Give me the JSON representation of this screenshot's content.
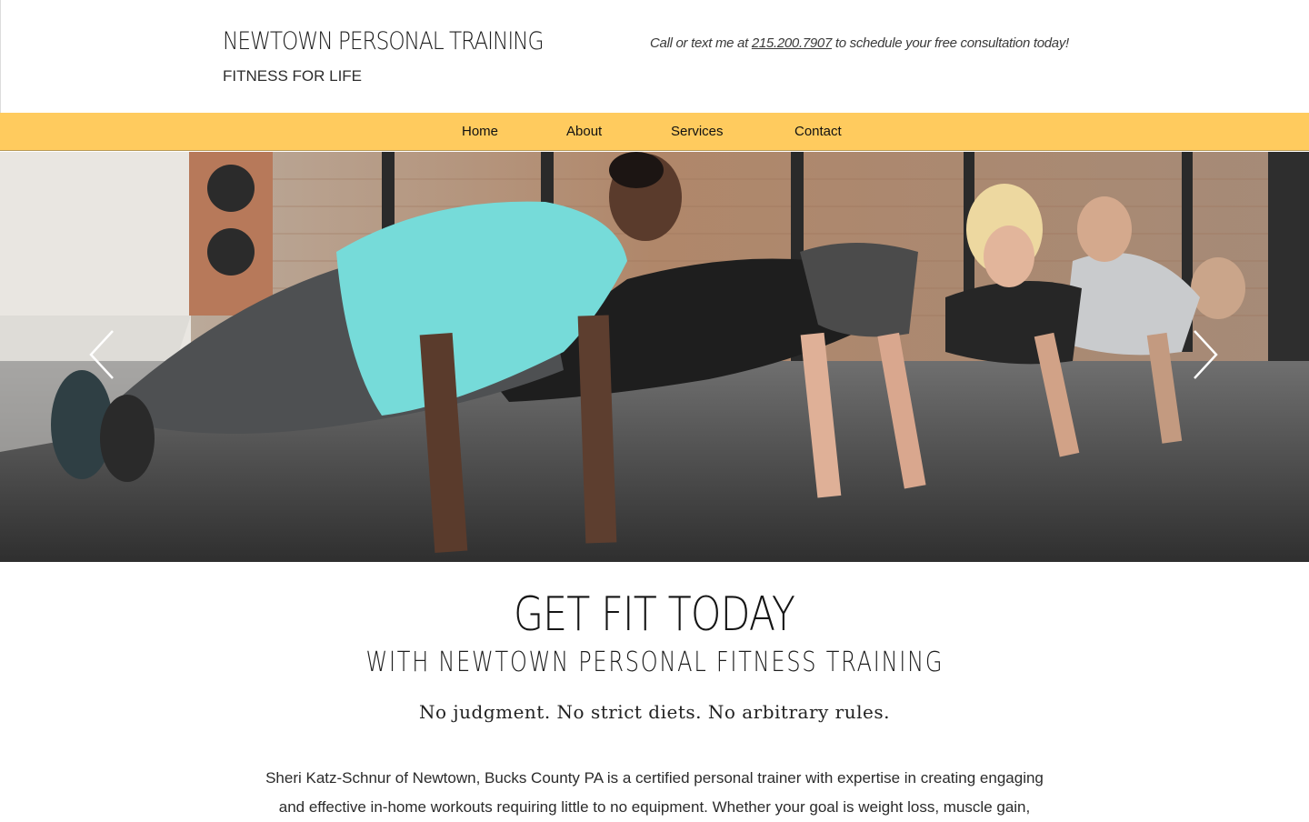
{
  "header": {
    "title": "NEWTOWN PERSONAL TRAINING",
    "tagline": "FITNESS FOR LIFE",
    "cta_prefix": "Call or text me at ",
    "cta_phone": "215.200.7907",
    "cta_suffix": " to schedule your free consultation today!"
  },
  "nav": {
    "items": [
      {
        "label": "Home"
      },
      {
        "label": "About"
      },
      {
        "label": "Services"
      },
      {
        "label": "Contact"
      }
    ]
  },
  "hero": {
    "image_icon": "fitness-group-pushups-photo",
    "prev_icon": "chevron-left-icon",
    "next_icon": "chevron-right-icon"
  },
  "content": {
    "heading": "GET FIT TODAY",
    "subheading": "WITH NEWTOWN PERSONAL FITNESS TRAINING",
    "tagline": "No judgment. No strict diets. No arbitrary rules.",
    "body_line1": "Sheri Katz-Schnur of Newtown, Bucks County PA is a certified personal trainer with expertise in creating engaging",
    "body_line2": "and effective in-home workouts requiring little to no equipment. Whether your goal is weight loss, muscle gain,"
  },
  "colors": {
    "nav_bg": "#ffcb5e",
    "text": "#1f1f1f",
    "background": "#ffffff"
  }
}
